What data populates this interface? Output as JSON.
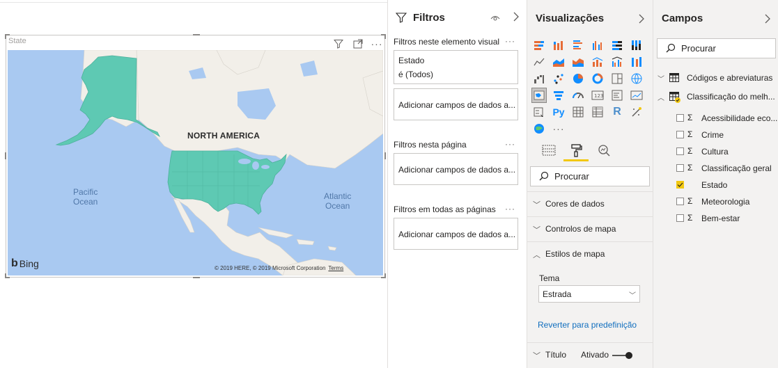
{
  "visual": {
    "title": "State",
    "map_labels": {
      "north_america": "NORTH AMERICA",
      "pacific_line1": "Pacific",
      "pacific_line2": "Ocean",
      "atlantic_line1": "Atlantic",
      "atlantic_line2": "Ocean"
    },
    "bing": "Bing",
    "copyright": "© 2019 HERE, © 2019 Microsoft Corporation",
    "terms": "Terms",
    "highlight_color": "#5ec9b3",
    "ocean_color": "#a9c9f1",
    "land_color": "#f2efe9"
  },
  "filters": {
    "title": "Filtros",
    "visual_section": "Filtros neste elemento visual",
    "estado_field": "Estado",
    "estado_value": "é (Todos)",
    "add_fields": "Adicionar campos de dados a...",
    "page_section": "Filtros nesta página",
    "all_pages_section": "Filtros em todas as páginas",
    "more": "···"
  },
  "visualizations": {
    "title": "Visualizações",
    "more": "···",
    "search_placeholder": "Procurar",
    "accordions": {
      "cores": "Cores de dados",
      "controlos": "Controlos de mapa",
      "estilos": "Estilos de mapa",
      "titulo": "Título"
    },
    "tema_label": "Tema",
    "tema_value": "Estrada",
    "revert_link": "Reverter para predefinição",
    "titulo_toggle": "Ativado"
  },
  "fields": {
    "title": "Campos",
    "search_placeholder": "Procurar",
    "tables": [
      {
        "label": "Códigos e abreviaturas"
      },
      {
        "label": "Classificação do melh..."
      }
    ],
    "items": [
      {
        "label": "Acessibilidade eco...",
        "sigma": "Σ",
        "checked": false
      },
      {
        "label": "Crime",
        "sigma": "Σ",
        "checked": false
      },
      {
        "label": "Cultura",
        "sigma": "Σ",
        "checked": false
      },
      {
        "label": "Classificação geral",
        "sigma": "Σ",
        "checked": false
      },
      {
        "label": "Estado",
        "sigma": "",
        "checked": true
      },
      {
        "label": "Meteorologia",
        "sigma": "Σ",
        "checked": false
      },
      {
        "label": "Bem-estar",
        "sigma": "Σ",
        "checked": false
      }
    ],
    "accent_color": "#f2c811"
  }
}
